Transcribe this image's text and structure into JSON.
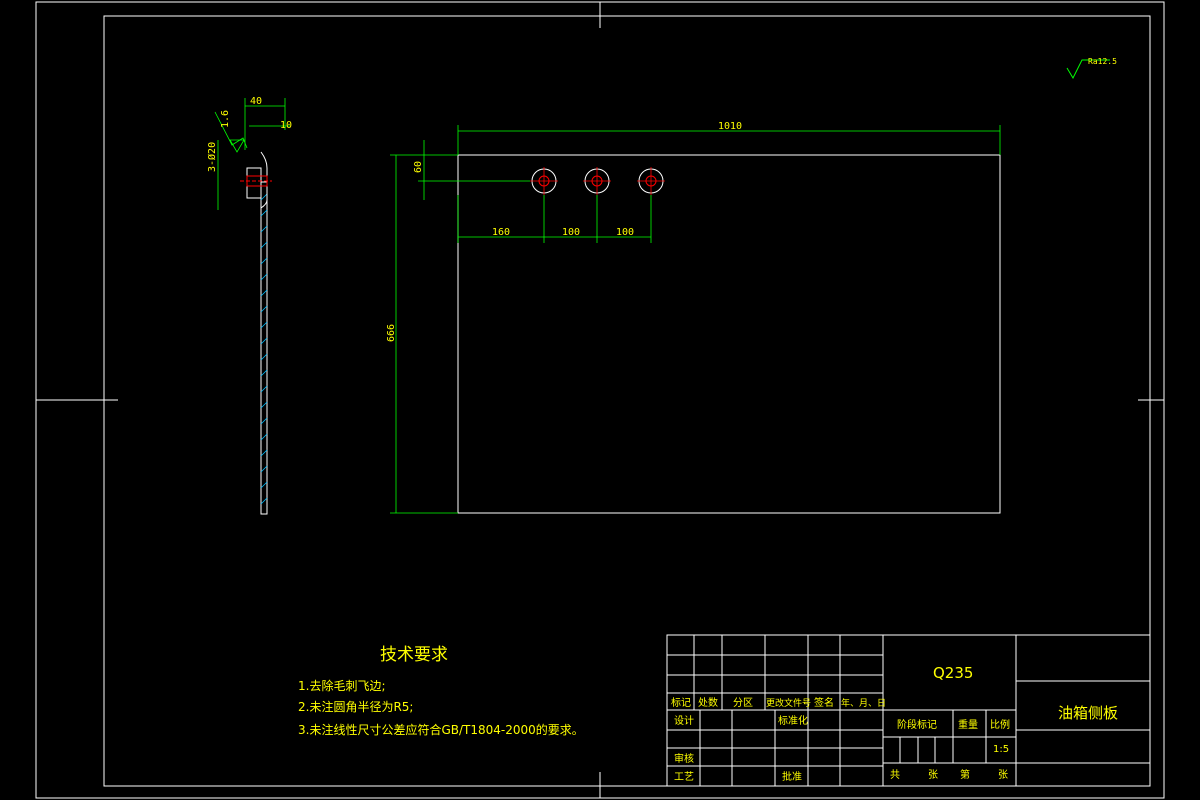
{
  "colors": {
    "background": "#000000",
    "frame": "#ffffff",
    "dimension": "#00ff00",
    "annotation_text": "#ffff00",
    "hole_center": "#ff0000",
    "hatch": "#00bfff"
  },
  "roughness": {
    "symbol": "Ra12.5"
  },
  "side_view": {
    "dim_width": "40",
    "dim_flange": "10",
    "dim_thickness": "1.6",
    "dim_hole": "3-Ø20"
  },
  "front_view": {
    "dim_length": "1010",
    "dim_height": "666",
    "dim_hole_offset": "60",
    "dim_hole_x1": "160",
    "dim_hole_x2": "100",
    "dim_hole_x3": "100"
  },
  "tech_requirements": {
    "title": "技术要求",
    "items": [
      "1.去除毛刺飞边;",
      "2.未注圆角半径为R5;",
      "3.未注线性尺寸公差应符合GB/T1804-2000的要求。"
    ]
  },
  "title_block": {
    "material": "Q235",
    "part_name": "油箱侧板",
    "rev_headers": [
      "标记",
      "处数",
      "分区",
      "更改文件号",
      "签名",
      "年、月、日"
    ],
    "design": "设计",
    "standardization": "标准化",
    "stage_mark": "阶段标记",
    "weight": "重量",
    "scale_label": "比例",
    "scale_value": "1:5",
    "review": "审核",
    "process": "工艺",
    "approve": "批准",
    "total": "共",
    "sheets": "张",
    "sheet_no": "第",
    "sheet_unit": "张"
  }
}
